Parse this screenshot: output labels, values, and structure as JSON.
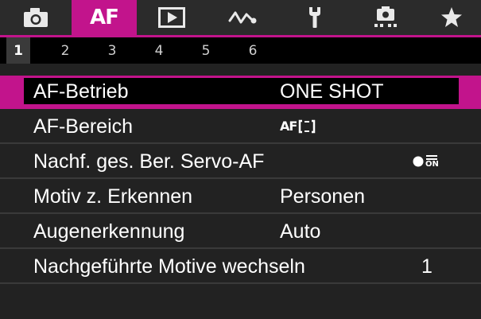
{
  "tabs": [
    {
      "name": "camera-icon"
    },
    {
      "label": "AF"
    },
    {
      "name": "play-icon"
    },
    {
      "name": "wireless-icon"
    },
    {
      "name": "wrench-icon"
    },
    {
      "name": "custom-functions-icon"
    },
    {
      "name": "star-icon"
    }
  ],
  "subtabs": [
    "1",
    "2",
    "3",
    "4",
    "5",
    "6"
  ],
  "active_subtab": "1",
  "colors": {
    "accent": "#c2148c",
    "background": "#222222",
    "tabbar": "#2b2b2b"
  },
  "menu": {
    "items": [
      {
        "label": "AF-Betrieb",
        "value": "ONE SHOT"
      },
      {
        "label": "AF-Bereich",
        "value_icon": "af-area-frame-icon",
        "value_icon_text": "AF"
      },
      {
        "label": "Nachf. ges. Ber. Servo-AF",
        "value_icon": "tracking-on-icon",
        "value_icon_text": "ON"
      },
      {
        "label": "Motiv z. Erkennen",
        "value": "Personen"
      },
      {
        "label": "Augenerkennung",
        "value": "Auto"
      },
      {
        "label": "Nachgeführte Motive wechseln",
        "value": "1"
      }
    ]
  }
}
